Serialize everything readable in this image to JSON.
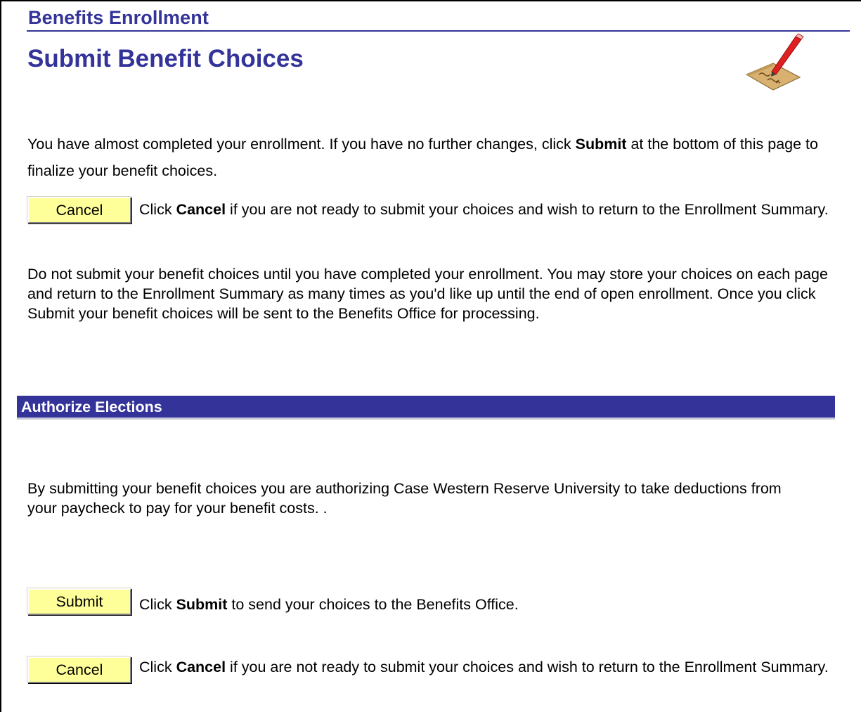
{
  "header": {
    "breadcrumb": "Benefits Enrollment",
    "title": "Submit Benefit Choices",
    "icon": "sign-document-icon"
  },
  "intro": {
    "before": "You have almost completed your enrollment. If you have no further changes, click ",
    "bold": "Submit",
    "after": " at the bottom of this page to finalize your benefit choices."
  },
  "cancel_top": {
    "button_label": "Cancel",
    "desc_before": "Click ",
    "desc_bold": "Cancel",
    "desc_after": " if you are not ready to submit your choices and wish to return to the Enrollment Summary."
  },
  "warning_text": "Do not submit your benefit choices until you have completed your enrollment. You may store your choices on each page and return to the Enrollment Summary as many times as you'd like up until the end of open enrollment. Once you click Submit your benefit choices will be sent to the Benefits Office for processing.",
  "authorize": {
    "section_title": "Authorize Elections",
    "text": "By submitting your benefit choices you are authorizing Case Western Reserve University to take deductions from your paycheck to pay for your benefit costs. ."
  },
  "submit": {
    "button_label": "Submit",
    "desc_before": "Click ",
    "desc_bold": "Submit",
    "desc_after": " to send your choices to the Benefits Office."
  },
  "cancel_bottom": {
    "button_label": "Cancel",
    "desc_before": "Click ",
    "desc_bold": "Cancel",
    "desc_after": " if you are not ready to submit your choices and wish to return to the Enrollment Summary."
  },
  "colors": {
    "brand": "#333399",
    "button_bg": "#ffff99",
    "section_text": "#ffffff"
  }
}
